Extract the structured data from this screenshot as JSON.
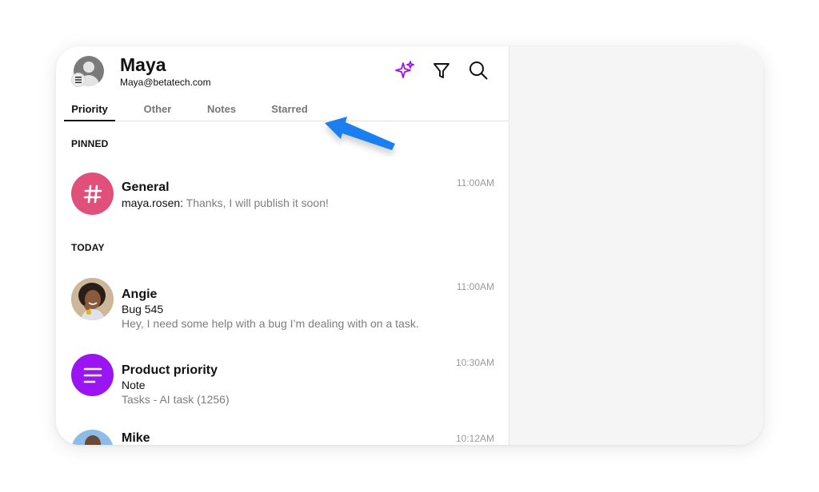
{
  "user": {
    "name": "Maya",
    "email": "Maya@betatech.com"
  },
  "header_icons": [
    "sparkle-icon",
    "filter-icon",
    "search-icon"
  ],
  "tabs": [
    {
      "label": "Priority",
      "active": true
    },
    {
      "label": "Other",
      "active": false
    },
    {
      "label": "Notes",
      "active": false
    },
    {
      "label": "Starred",
      "active": false
    }
  ],
  "sections": {
    "pinned": "PINNED",
    "today": "TODAY"
  },
  "pinned": [
    {
      "title": "General",
      "sender": "maya.rosen:",
      "preview": " Thanks, I will publish it soon!",
      "time": "11:00AM",
      "avatar_color": "#e0507a",
      "icon": "hash-icon"
    }
  ],
  "today": [
    {
      "title": "Angie",
      "subtitle": "Bug 545",
      "preview": "Hey, I need some help with a bug I’m dealing with on a task.",
      "time": "11:00AM",
      "avatar": "photo"
    },
    {
      "title": "Product priority",
      "subtitle": "Note",
      "preview": "Tasks - AI task (1256)",
      "time": "10:30AM",
      "avatar_color": "#9b14f2",
      "icon": "note-lines-icon"
    },
    {
      "title": "Mike",
      "time": "10:12AM",
      "avatar": "photo"
    }
  ],
  "colors": {
    "accent_purple": "#9b14f2",
    "hash_pink": "#e0507a",
    "arrow_blue": "#1a7ff0"
  }
}
